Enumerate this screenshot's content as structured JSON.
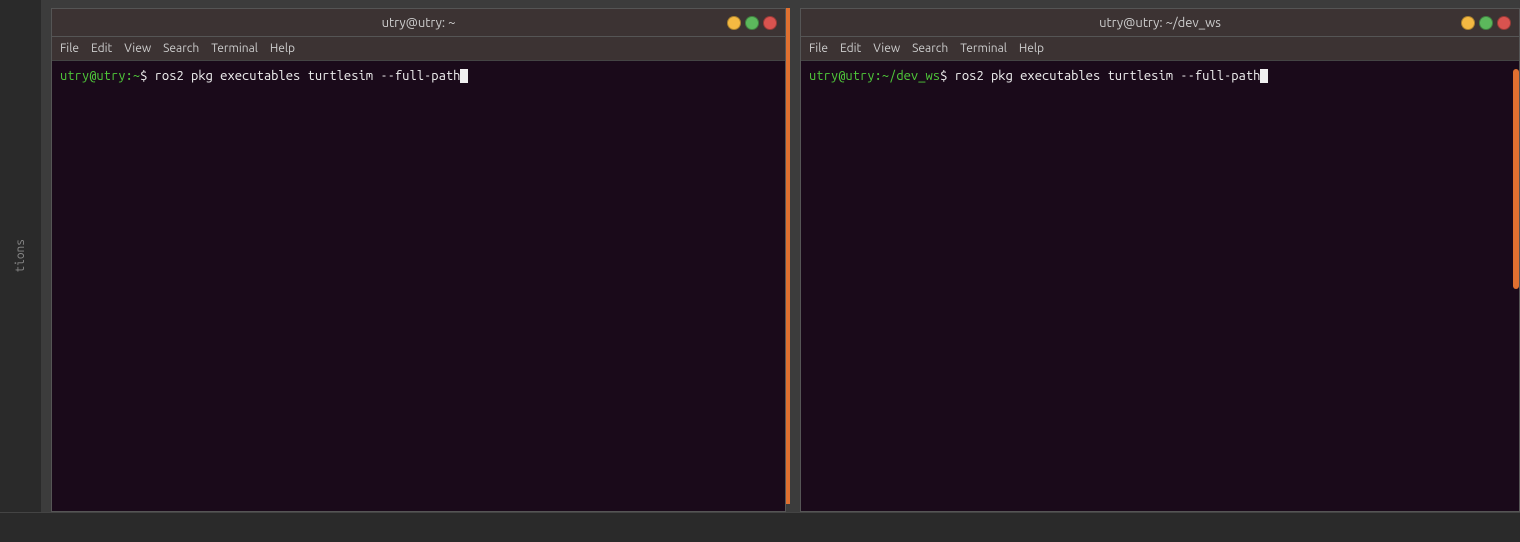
{
  "terminal_left": {
    "title": "utry@utry: ~",
    "menu": {
      "file": "File",
      "edit": "Edit",
      "view": "View",
      "search": "Search",
      "terminal": "Terminal",
      "help": "Help"
    },
    "prompt_user": "utry@utry:",
    "prompt_path": "~",
    "prompt_symbol": "$",
    "command": " ros2 pkg executables turtlesim --full-path"
  },
  "terminal_right": {
    "title": "utry@utry: ~/dev_ws",
    "menu": {
      "file": "File",
      "edit": "Edit",
      "view": "View",
      "search": "Search",
      "terminal": "Terminal",
      "help": "Help"
    },
    "prompt_user": "utry@utry:",
    "prompt_path": "~/dev_ws",
    "prompt_symbol": "$",
    "command": " ros2 pkg executables turtlesim --full-path"
  },
  "sidebar": {
    "label": "tions"
  },
  "window_controls": {
    "minimize_label": "minimize",
    "maximize_label": "maximize",
    "close_label": "close"
  }
}
